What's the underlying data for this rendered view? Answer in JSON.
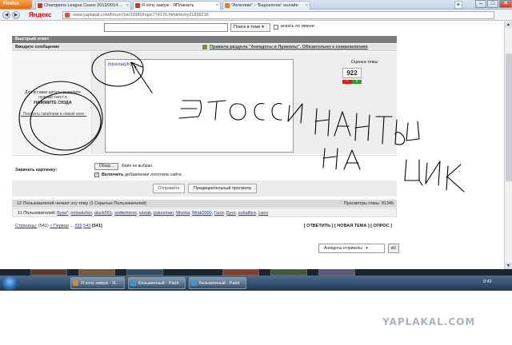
{
  "browser": {
    "app_button": "Firefox",
    "yandex_logo": "Яндекс",
    "tabs": [
      {
        "label": "Champions League Сезон 2013/2014 ...",
        "fav_color": "#c0392b"
      },
      {
        "label": "Я хочу замуж - ЯПлакалъ",
        "fav_color": "#c0392b"
      },
      {
        "label": "\"Атлетико\" - \"Барселона\" онлайн",
        "fav_color": "#e67e22"
      }
    ],
    "new_tab": "+",
    "url": "www.yaplakal.com/forum7/st/33980/topic774176.html#entry21828216",
    "window_controls": {
      "minimize": "–",
      "maximize": "□",
      "close": "✕"
    }
  },
  "page": {
    "search": {
      "button": "Поиск в теме",
      "only_by_name": "искать по имени"
    },
    "quick_reply": {
      "header": "Быстрый ответ",
      "enter_message": "Введите сообщение",
      "rules_link": "Правила раздела \"Анекдоты и Приколы\". Обязательно к ознакомлению",
      "quote_hint": "Для вставки цитаты выделите нужный текст и",
      "quote_action": "НАЖМИТЕ СЮДА",
      "smiles_link": "· Показать смайлики в новом окне ·",
      "editor_text": "[b]wiziak[/b]"
    },
    "rating": {
      "label": "Оценка темы",
      "value": "922",
      "minus": "–",
      "plus": "+"
    },
    "upload": {
      "label": "Закачать картинку:",
      "browse": "Обзор...",
      "no_file": "Файл не выбран.",
      "logo_strong": "Включить",
      "logo_rest": " добавление логотипа сайта"
    },
    "buttons": {
      "send": "Отправить",
      "preview": "Предварительный просмотр"
    },
    "readers": "12 Пользователей читают эту тему (1 Скрытых Пользователей)",
    "views": "Просмотры темы: 91345",
    "users_prefix": "11 Пользователей:",
    "users": [
      "Бука*",
      "netwatcher",
      "aluck551",
      "xxdiemerxx",
      "wiziak",
      "pskovman",
      "Wonka",
      "Mrak2000",
      "Гыхх",
      "Бухх",
      "zubalibre",
      "Leex"
    ],
    "pagination": {
      "label": "Страницы:",
      "count": "(541)",
      "first": "« Первая",
      "dots": "...",
      "p1": "539",
      "p2": "540",
      "current": "[541]"
    },
    "actions": "[ ОТВЕТИТЬ ] [ НОВАЯ ТЕМА ] [ ОПРОС ]",
    "forum_select": "· Анекдоты и приколы ·",
    "ok": "ok!"
  },
  "scribble_text": "ЭТО ССКИ НАЖАТЬ НА ЦИК",
  "taskbar": {
    "tasks": [
      {
        "label": "Я хочу замуж - Я...",
        "icon_color": "#e67e22"
      },
      {
        "label": "Безымянный - Paint",
        "icon_color": "#3498db"
      },
      {
        "label": "Безымянный - Paint",
        "icon_color": "#3498db"
      }
    ],
    "clock": "0:42"
  },
  "watermark": "YAPLAKAL.COM"
}
